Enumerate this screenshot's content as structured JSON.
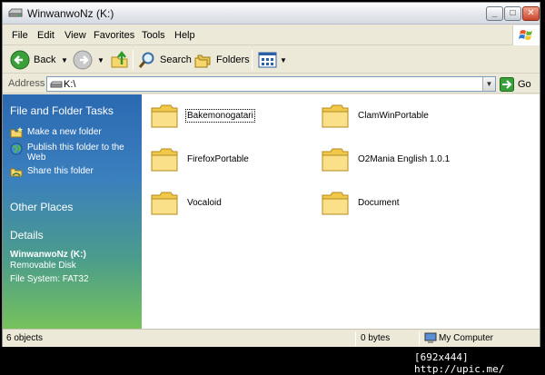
{
  "window": {
    "title": "WinwanwoNz (K:)",
    "controls": [
      "minimize",
      "maximize",
      "close"
    ]
  },
  "menu": {
    "items": [
      "File",
      "Edit",
      "View",
      "Favorites",
      "Tools",
      "Help"
    ]
  },
  "toolbar": {
    "back_label": "Back",
    "search_label": "Search",
    "folders_label": "Folders"
  },
  "address": {
    "label": "Address",
    "value": "K:\\",
    "go_label": "Go"
  },
  "task_pane": {
    "file_tasks_heading": "File and Folder Tasks",
    "tasks": [
      {
        "label": "Make a new folder",
        "icon": "new-folder-icon"
      },
      {
        "label": "Publish this folder to the Web",
        "icon": "globe-icon"
      },
      {
        "label": "Share this folder",
        "icon": "share-folder-icon"
      }
    ],
    "other_places_heading": "Other Places",
    "details_heading": "Details",
    "details": {
      "name": "WinwanwoNz (K:)",
      "type": "Removable Disk",
      "filesystem": "File System: FAT32"
    }
  },
  "files": [
    {
      "name": "Bakemonogatari",
      "selected": true
    },
    {
      "name": "ClamWinPortable",
      "selected": false
    },
    {
      "name": "FirefoxPortable",
      "selected": false
    },
    {
      "name": "O2Mania English 1.0.1",
      "selected": false
    },
    {
      "name": "Vocaloid",
      "selected": false
    },
    {
      "name": "Document",
      "selected": false
    }
  ],
  "status": {
    "objects": "6 objects",
    "size": "0 bytes",
    "location": "My Computer"
  },
  "footer": {
    "watermark": "[692x444] http://upic.me/"
  },
  "colors": {
    "task_pane_top": "#2b69b1",
    "task_pane_bottom": "#76c25c",
    "folder_yellow": "#f5d76e"
  }
}
